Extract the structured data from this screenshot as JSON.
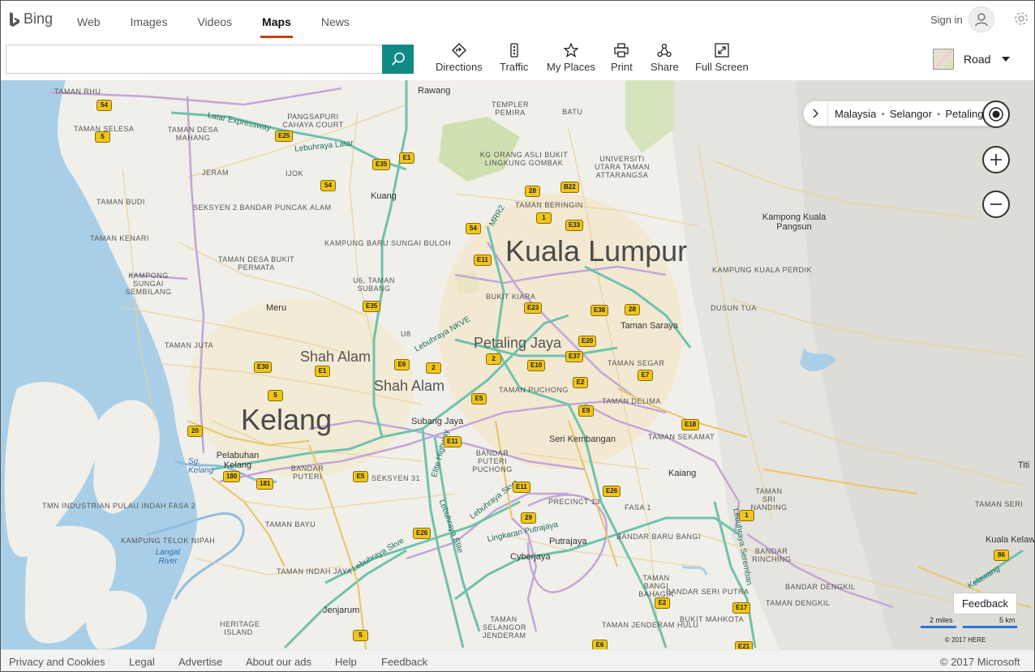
{
  "brand": {
    "name": "Bing"
  },
  "nav": {
    "tabs": [
      {
        "label": "Web",
        "active": false
      },
      {
        "label": "Images",
        "active": false
      },
      {
        "label": "Videos",
        "active": false
      },
      {
        "label": "Maps",
        "active": true
      },
      {
        "label": "News",
        "active": false
      }
    ],
    "sign_in": "Sign in"
  },
  "search": {
    "value": "",
    "placeholder": ""
  },
  "toolbar": {
    "directions": "Directions",
    "traffic": "Traffic",
    "my_places": "My Places",
    "print": "Print",
    "share": "Share",
    "full_screen": "Full Screen",
    "map_style": "Road"
  },
  "breadcrumb": [
    "Malaysia",
    "Selangor",
    "Petaling"
  ],
  "map": {
    "cities": {
      "kuala_lumpur": "Kuala Lumpur",
      "kelang": "Kelang",
      "petaling_jaya": "Petaling Jaya",
      "shah_alam_1": "Shah Alam",
      "shah_alam_2": "Shah Alam"
    },
    "towns": {
      "rawang": "Rawang",
      "kuang": "Kuang",
      "meru": "Meru",
      "subang_jaya": "Subang Jaya",
      "seri_kembangan": "Seri Kembangan",
      "kaiang": "Kaiang",
      "putrajaya": "Putrajaya",
      "cyberjaya": "Cyberjaya",
      "jenjarum": "Jenjarum",
      "pelabuhan_kelang": "Pelabuhan Kelang",
      "taman_saraya": "Taman Saraya",
      "kampong_kuala_pangsun": "Kampong Kuala Pangsun",
      "kuala_kelawa": "Kuala Kelawa",
      "titi": "Titi"
    },
    "areas": {
      "taman_rhu": "TAMAN RHU",
      "taman_selesa": "TAMAN SELESA",
      "taman_desa_mahang": "TAMAN DESA MAHANG",
      "pangsapuri_cahaya": "PANGSAPURI CAHAYA COURT",
      "jeram": "JERAM",
      "ijok": "IJOK",
      "taman_budi": "TAMAN BUDI",
      "seksyen_2": "SEKSYEN 2 BANDAR PUNCAK ALAM",
      "taman_kenari": "TAMAN KENARI",
      "kampung_baru_sungai_buloh": "KAMPUNG BARU SUNGAI BULOH",
      "taman_desa_bukit": "TAMAN DESA BUKIT PERMATA",
      "kampong_sungai_sembilang": "KAMPONG SUNGAI SEMBILANG",
      "u6": "U6, TAMAN SUBANG",
      "u8": "U8",
      "taman_juta": "TAMAN JUTA",
      "templer": "TEMPLER PEMIRA",
      "batu": "BATU",
      "kg_orang_asli": "KG ORANG ASLI BUKIT LINGKUNG GOMBAK",
      "universiti_utara": "UNIVERSITI UTARA TAMAN ATTARANGSA",
      "taman_beringin": "TAMAN BERINGIN",
      "bukit_kiara": "BUKIT KIARA",
      "kampung_kuala_perdik": "KAMPUNG KUALA PERDIK",
      "dusun_tua": "DUSUN TUA",
      "taman_segar": "TAMAN SEGAR",
      "taman_puchong": "TAMAN PUCHONG",
      "taman_delima": "TAMAN DELIMA",
      "taman_sekamat": "TAMAN SEKAMAT",
      "bandar_puteri": "BANDAR PUTERI",
      "seksyen_31": "SEKSYEN 31",
      "bandar_puteri_puchong": "BANDAR PUTERI PUCHONG",
      "tmn_industrian": "TMN INDUSTRIAN PULAU INDAH FASA 2",
      "taman_bayu": "TAMAN BAYU",
      "kampung_telok_nipah": "KAMPUNG TELOK NIPAH",
      "taman_indah_jaya": "TAMAN INDAH JAYA",
      "heritage_island": "HERITAGE ISLAND",
      "precinct_13": "PRECINCT 13",
      "fasa_1": "FASA 1",
      "bandar_baru_bangi": "BANDAR BARU BANGI",
      "bandar_rinching": "BANDAR RINCHING",
      "taman_bangi_bahagia": "TAMAN BANGI BAHAGIA",
      "bandar_seri_putra": "BANDAR SERI PUTRA",
      "taman_selangor_jenderam": "TAMAN SELANGOR JENDERAM",
      "taman_jenderam_hulu": "TAMAN JENDERAM HULU",
      "bukit_mahkota": "BUKIT MAHKOTA",
      "bandar_dengkil": "BANDAR DENGKIL",
      "taman_dengkil": "TAMAN DENGKIL",
      "taman_sri_nanding": "TAMAN SRI NANDING",
      "taman_seri": "TAMAN SERI"
    },
    "roads": {
      "latar_expressway": "Latar Expressway",
      "lebuhraya_latar": "Lebuhraya Latar",
      "lebuhraya_nkve": "Lebuhraya NKVE",
      "elite_highway": "Elite Highway",
      "lebuhraya_skve": "Lebuhraya Skve",
      "lebuhraya_skve_2": "Lebuhraya Skve",
      "lebuhraya_elite": "Lebuhraya Elite",
      "lingkaran_putrajaya": "Lingkaran Putrajaya",
      "mrr2": "MRR2",
      "seremban": "Lebuhraya Seremban",
      "kelawang": "Kelawang"
    },
    "water": {
      "sg_kelang": "Sg. Kelang",
      "langat_river": "Langat River"
    },
    "shields": [
      "54",
      "5",
      "E25",
      "E35",
      "E1",
      "54",
      "28",
      "B22",
      "1",
      "E33",
      "54",
      "E11",
      "E35",
      "E23",
      "E38",
      "28",
      "E20",
      "E37",
      "E30",
      "E1",
      "E6",
      "2",
      "2",
      "E10",
      "E2",
      "E7",
      "5",
      "E5",
      "E9",
      "E18",
      "20",
      "E11",
      "180",
      "181",
      "E5",
      "E11",
      "E26",
      "29",
      "1",
      "E26",
      "86",
      "E2",
      "5",
      "E6",
      "E21",
      "E17"
    ]
  },
  "controls": {
    "feedback": "Feedback",
    "scale_miles": "2 miles",
    "scale_km": "5 km",
    "map_copyright": "© 2017 HERE"
  },
  "footer": {
    "links": [
      "Privacy and Cookies",
      "Legal",
      "Advertise",
      "About our ads",
      "Help",
      "Feedback"
    ],
    "copyright": "© 2017 Microsoft"
  }
}
